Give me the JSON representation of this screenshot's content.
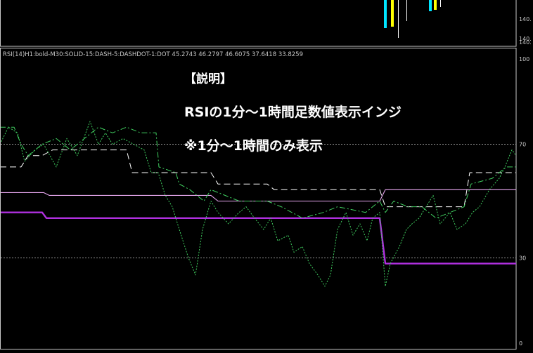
{
  "chart_data": {
    "type": "line",
    "top_panel": {
      "price_labels": [
        "140.",
        "140.",
        "140."
      ],
      "bars": [
        {
          "color": "#00e5ff",
          "top": 140.0,
          "bottom": 140.0
        },
        {
          "color": "#ffff00",
          "top": 140.0,
          "bottom": 140.0
        }
      ]
    },
    "indicator_header": "RSI(14)H1:bold-M30:SOLID-15:DASH-5:DASHDOT-1:DOT 45.2743 46.2797 46.6075 37.6418 33.8259",
    "annotations": [
      "【説明】",
      "RSIの1分～1時間足数値表示インジ",
      "※1分～1時間のみ表示"
    ],
    "ylim": [
      0,
      100
    ],
    "y_ticks": [
      100,
      70,
      30,
      0
    ],
    "levels": [
      70,
      30
    ],
    "series": [
      {
        "name": "H1",
        "color": "#b030e0",
        "style": "bold",
        "values": [
          [
            0,
            46
          ],
          [
            60,
            46
          ],
          [
            66,
            44
          ],
          [
            120,
            44
          ],
          [
            200,
            44
          ],
          [
            300,
            44
          ],
          [
            400,
            44
          ],
          [
            480,
            44
          ],
          [
            540,
            44
          ],
          [
            548,
            28
          ],
          [
            600,
            28
          ],
          [
            680,
            28
          ],
          [
            758,
            28
          ]
        ]
      },
      {
        "name": "M30",
        "color": "#e8a8f0",
        "style": "solid",
        "values": [
          [
            0,
            53
          ],
          [
            62,
            53
          ],
          [
            70,
            52
          ],
          [
            150,
            52
          ],
          [
            250,
            52
          ],
          [
            300,
            52
          ],
          [
            310,
            50
          ],
          [
            400,
            50
          ],
          [
            500,
            50
          ],
          [
            540,
            50
          ],
          [
            548,
            54
          ],
          [
            600,
            54
          ],
          [
            700,
            54
          ],
          [
            758,
            54
          ]
        ]
      },
      {
        "name": "M15",
        "color": "#ffffff",
        "style": "dash",
        "values": [
          [
            0,
            62
          ],
          [
            30,
            62
          ],
          [
            40,
            66
          ],
          [
            60,
            66
          ],
          [
            75,
            68
          ],
          [
            100,
            68
          ],
          [
            140,
            68
          ],
          [
            180,
            68
          ],
          [
            188,
            60
          ],
          [
            210,
            60
          ],
          [
            300,
            60
          ],
          [
            310,
            56
          ],
          [
            380,
            56
          ],
          [
            390,
            54
          ],
          [
            440,
            54
          ],
          [
            540,
            54
          ],
          [
            548,
            48
          ],
          [
            580,
            48
          ],
          [
            600,
            48
          ],
          [
            660,
            48
          ],
          [
            668,
            60
          ],
          [
            720,
            60
          ],
          [
            758,
            60
          ]
        ]
      },
      {
        "name": "M5",
        "color": "#40d060",
        "style": "dashdot",
        "values": [
          [
            0,
            76
          ],
          [
            20,
            76
          ],
          [
            30,
            70
          ],
          [
            40,
            66
          ],
          [
            60,
            70
          ],
          [
            80,
            72
          ],
          [
            100,
            68
          ],
          [
            120,
            72
          ],
          [
            140,
            76
          ],
          [
            160,
            74
          ],
          [
            180,
            76
          ],
          [
            200,
            74
          ],
          [
            222,
            74
          ],
          [
            226,
            62
          ],
          [
            250,
            60
          ],
          [
            255,
            56
          ],
          [
            270,
            54
          ],
          [
            290,
            50
          ],
          [
            300,
            54
          ],
          [
            320,
            52
          ],
          [
            340,
            50
          ],
          [
            380,
            50
          ],
          [
            400,
            48
          ],
          [
            430,
            44
          ],
          [
            460,
            46
          ],
          [
            480,
            48
          ],
          [
            520,
            46
          ],
          [
            540,
            50
          ],
          [
            548,
            46
          ],
          [
            560,
            50
          ],
          [
            580,
            48
          ],
          [
            600,
            48
          ],
          [
            620,
            44
          ],
          [
            640,
            46
          ],
          [
            660,
            48
          ],
          [
            670,
            56
          ],
          [
            700,
            58
          ],
          [
            720,
            62
          ],
          [
            758,
            62
          ]
        ]
      },
      {
        "name": "M1",
        "color": "#40d060",
        "style": "dot",
        "values": [
          [
            0,
            70
          ],
          [
            12,
            76
          ],
          [
            25,
            74
          ],
          [
            35,
            64
          ],
          [
            50,
            68
          ],
          [
            62,
            70
          ],
          [
            80,
            62
          ],
          [
            95,
            72
          ],
          [
            110,
            66
          ],
          [
            128,
            78
          ],
          [
            140,
            70
          ],
          [
            150,
            74
          ],
          [
            160,
            70
          ],
          [
            175,
            72
          ],
          [
            190,
            70
          ],
          [
            205,
            68
          ],
          [
            215,
            60
          ],
          [
            225,
            60
          ],
          [
            235,
            52
          ],
          [
            245,
            48
          ],
          [
            255,
            40
          ],
          [
            268,
            30
          ],
          [
            278,
            24
          ],
          [
            288,
            40
          ],
          [
            300,
            50
          ],
          [
            310,
            46
          ],
          [
            325,
            42
          ],
          [
            340,
            46
          ],
          [
            350,
            48
          ],
          [
            362,
            44
          ],
          [
            375,
            40
          ],
          [
            385,
            44
          ],
          [
            395,
            36
          ],
          [
            410,
            38
          ],
          [
            418,
            32
          ],
          [
            430,
            34
          ],
          [
            440,
            28
          ],
          [
            452,
            24
          ],
          [
            462,
            20
          ],
          [
            470,
            24
          ],
          [
            480,
            40
          ],
          [
            492,
            46
          ],
          [
            502,
            38
          ],
          [
            512,
            42
          ],
          [
            522,
            36
          ],
          [
            530,
            44
          ],
          [
            540,
            46
          ],
          [
            548,
            20
          ],
          [
            555,
            28
          ],
          [
            568,
            34
          ],
          [
            578,
            40
          ],
          [
            586,
            42
          ],
          [
            596,
            44
          ],
          [
            606,
            48
          ],
          [
            616,
            52
          ],
          [
            626,
            42
          ],
          [
            640,
            46
          ],
          [
            650,
            40
          ],
          [
            662,
            42
          ],
          [
            672,
            46
          ],
          [
            682,
            48
          ],
          [
            696,
            54
          ],
          [
            710,
            58
          ],
          [
            718,
            62
          ],
          [
            728,
            68
          ],
          [
            740,
            64
          ],
          [
            752,
            60
          ]
        ]
      }
    ]
  }
}
